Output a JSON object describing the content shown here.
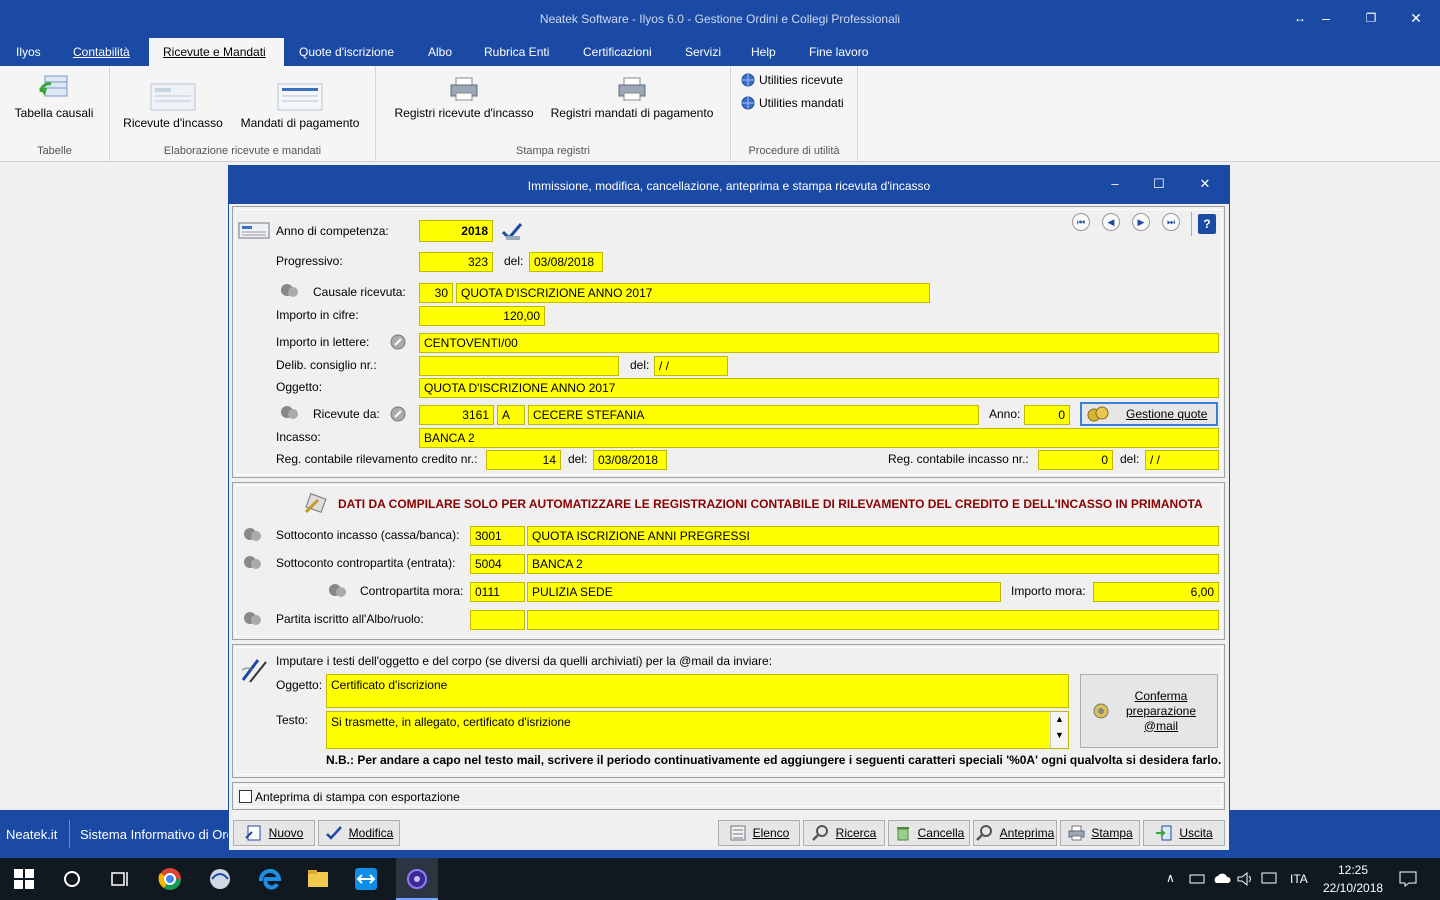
{
  "window": {
    "title": "Neatek Software - Ilyos 6.0 - Gestione Ordini e Collegi Professionali",
    "resize_glyph": "↔",
    "minimize": "‒",
    "maximize": "❐",
    "close": "✕"
  },
  "menu": {
    "items": [
      "Ilyos",
      "Contabilità",
      "Ricevute e Mandati",
      "Quote d'iscrizione",
      "Albo",
      "Rubrica Enti",
      "Certificazioni",
      "Servizi",
      "Help",
      "Fine lavoro"
    ],
    "active": "Ricevute e Mandati"
  },
  "ribbon": {
    "groups": {
      "tabelle": {
        "label": "Tabelle",
        "buttons": [
          "Tabella causali"
        ]
      },
      "elaborazione": {
        "label": "Elaborazione ricevute e mandati",
        "buttons": [
          "Ricevute d'incasso",
          "Mandati di pagamento"
        ]
      },
      "stampa": {
        "label": "Stampa registri",
        "buttons": [
          "Registri ricevute d'incasso",
          "Registri mandati di pagamento"
        ]
      },
      "procedure": {
        "label": "Procedure di utilità",
        "buttons": [
          "Utilities ricevute",
          "Utilities mandati"
        ]
      }
    }
  },
  "statusbar": {
    "left": "Neatek.it",
    "center": "Sistema Informativo di Orc"
  },
  "dialog": {
    "title": "Immissione, modifica, cancellazione, anteprima e stampa ricevuta d'incasso",
    "minimize": "‒",
    "maximize": "☐",
    "close": "✕",
    "nav": [
      "⏮",
      "◀",
      "▶",
      "⏭"
    ],
    "help_icon": "?",
    "labels": {
      "anno": "Anno di competenza:",
      "progressivo": "Progressivo:",
      "del": "del:",
      "causale": "Causale ricevuta:",
      "importo_cifre": "Importo in cifre:",
      "importo_lettere": "Importo in lettere:",
      "delib": "Delib. consiglio nr.:",
      "oggetto": "Oggetto:",
      "ricevute_da": "Ricevute da:",
      "anno2": "Anno:",
      "incasso": "Incasso:",
      "reg_credito": "Reg. contabile rilevamento credito nr.:",
      "reg_incasso": "Reg. contabile incasso nr.:"
    },
    "values": {
      "anno": "2018",
      "progressivo": "323",
      "progressivo_data": "03/08/2018",
      "causale_cod": "30",
      "causale_desc": "QUOTA D'ISCRIZIONE ANNO 2017",
      "importo_cifre": "120,00",
      "importo_lettere": "CENTOVENTI/00",
      "delib_nr": "",
      "delib_data": " /  /",
      "oggetto": "QUOTA D'ISCRIZIONE ANNO 2017",
      "ricevente_cod": "3161",
      "ricevente_tipo": "A",
      "ricevente_nome": "CECERE STEFANIA",
      "anno2": "0",
      "incasso": "BANCA 2",
      "reg_credito_nr": "14",
      "reg_credito_data": "03/08/2018",
      "reg_incasso_nr": "0",
      "reg_incasso_data": " /  /"
    },
    "gestione_quote": "Gestione quote",
    "accounting": {
      "heading": "DATI DA COMPILARE SOLO PER AUTOMATIZZARE LE REGISTRAZIONI CONTABILE DI RILEVAMENTO DEL CREDITO E DELL'INCASSO IN PRIMANOTA",
      "sottoconto_incasso_label": "Sottoconto incasso (cassa/banca):",
      "sottoconto_incasso_cod": "3001",
      "sottoconto_incasso_desc": "QUOTA ISCRIZIONE ANNI PREGRESSI",
      "contropartita_label": "Sottoconto contropartita (entrata):",
      "contropartita_cod": "5004",
      "contropartita_desc": "BANCA 2",
      "mora_label": "Contropartita mora:",
      "mora_cod": "0111",
      "mora_desc": "PULIZIA SEDE",
      "importo_mora_label": "Importo mora:",
      "importo_mora": "6,00",
      "partita_label": "Partita iscritto all'Albo/ruolo:",
      "partita_cod": "",
      "partita_desc": ""
    },
    "email": {
      "intro": "Imputare i testi dell'oggetto e del corpo (se diversi da quelli archiviati) per la @mail da inviare:",
      "oggetto_label": "Oggetto:",
      "oggetto": "Certificato d'iscrizione",
      "testo_label": "Testo:",
      "testo": "Si trasmette, in allegato, certificato d'isrizione",
      "conferma": "Conferma preparazione @mail",
      "nb": "N.B.: Per andare a capo nel testo mail, scrivere il periodo continuativamente ed aggiungere i seguenti caratteri speciali  '%0A'  ogni qualvolta si desidera farlo."
    },
    "anteprima_checkbox": "Anteprima di stampa con esportazione",
    "buttons": {
      "nuovo": "Nuovo",
      "modifica": "Modifica",
      "elenco": "Elenco",
      "ricerca": "Ricerca",
      "cancella": "Cancella",
      "anteprima": "Anteprima",
      "stampa": "Stampa",
      "uscita": "Uscita"
    }
  },
  "taskbar": {
    "lang": "ITA",
    "time": "12:25",
    "date": "22/10/2018"
  },
  "colors": {
    "brand": "#1b4aa5",
    "field": "#ffff00",
    "heading": "#8b0000"
  }
}
